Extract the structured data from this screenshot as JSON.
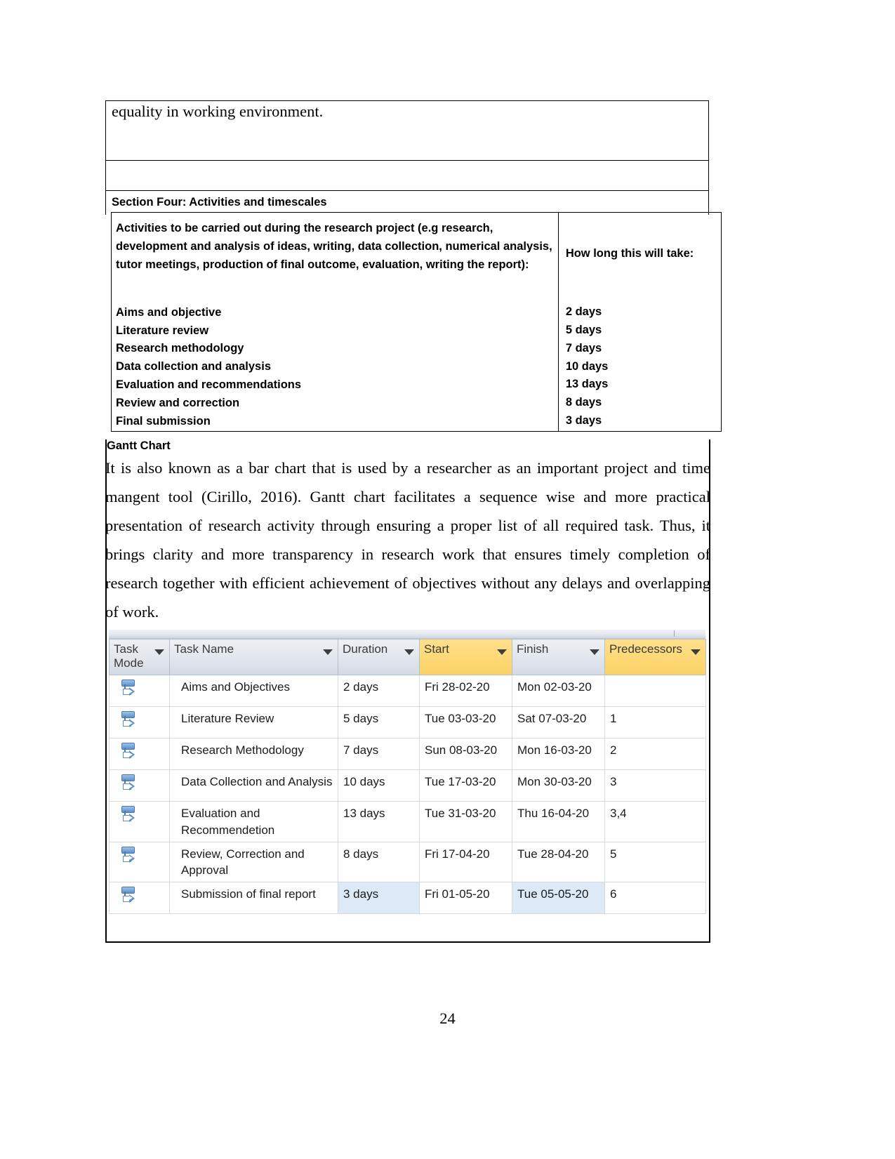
{
  "document": {
    "top_cell_text": "equality in working environment.",
    "section_four_label": "Section Four: Activities and timescales",
    "gantt_heading": "Gantt Chart",
    "gantt_paragraph": "It is also known as a bar chart that is used by a researcher as an important project and time mangent tool (Cirillo, 2016). Gantt chart facilitates a sequence wise and more practical presentation of research activity through ensuring a proper list of all required task. Thus, it brings clarity and  more transparency in research work that ensures timely completion of research together with efficient achievement of objectives without any delays and overlapping of work.",
    "page_number": "24"
  },
  "activities_table": {
    "header_left": "Activities to be carried out during the research project (e.g research, development and analysis of ideas, writing, data collection, numerical analysis, tutor meetings, production of final outcome, evaluation, writing the report):",
    "header_right": "How long this will take:",
    "rows": [
      {
        "activity": "Aims and objective",
        "duration": "2 days"
      },
      {
        "activity": "Literature review",
        "duration": "5 days"
      },
      {
        "activity": "Research methodology",
        "duration": "7 days"
      },
      {
        "activity": "Data collection and analysis",
        "duration": "10 days"
      },
      {
        "activity": "Evaluation and recommendations",
        "duration": "13 days"
      },
      {
        "activity": "Review and correction",
        "duration": "8 days"
      },
      {
        "activity": "Final submission",
        "duration": "3 days"
      }
    ]
  },
  "gantt_table": {
    "columns": [
      {
        "label": "Task Mode",
        "highlight": "none"
      },
      {
        "label": "Task Name",
        "highlight": "none"
      },
      {
        "label": "Duration",
        "highlight": "none"
      },
      {
        "label": "Start",
        "highlight": "gold"
      },
      {
        "label": "Finish",
        "highlight": "none"
      },
      {
        "label": "Predecessors",
        "highlight": "gold"
      }
    ],
    "colors": {
      "header_gold": "#ffd977",
      "header_grey": "#e2e7ee",
      "selection_blue": "#dce9f7",
      "task_mode_icon": "#5b8fc9"
    },
    "rows": [
      {
        "mode_icon": "manually-scheduled-icon",
        "name": "Aims and Objectives",
        "duration": "2 days",
        "start": "Fri 28-02-20",
        "finish": "Mon 02-03-20",
        "predecessors": ""
      },
      {
        "mode_icon": "manually-scheduled-icon",
        "name": "Literature Review",
        "duration": "5 days",
        "start": "Tue 03-03-20",
        "finish": "Sat 07-03-20",
        "predecessors": "1"
      },
      {
        "mode_icon": "manually-scheduled-icon",
        "name": "Research Methodology",
        "duration": "7 days",
        "start": "Sun 08-03-20",
        "finish": "Mon 16-03-20",
        "predecessors": "2"
      },
      {
        "mode_icon": "manually-scheduled-icon",
        "name": "Data Collection and Analysis",
        "duration": "10 days",
        "start": "Tue 17-03-20",
        "finish": "Mon 30-03-20",
        "predecessors": "3"
      },
      {
        "mode_icon": "manually-scheduled-icon",
        "name": "Evaluation and Recommendetion",
        "duration": "13 days",
        "start": "Tue 31-03-20",
        "finish": "Thu 16-04-20",
        "predecessors": "3,4"
      },
      {
        "mode_icon": "manually-scheduled-icon",
        "name": "Review, Correction and Approval",
        "duration": "8 days",
        "start": "Fri 17-04-20",
        "finish": "Tue 28-04-20",
        "predecessors": "5"
      },
      {
        "mode_icon": "manually-scheduled-icon",
        "name": "Submission of final report",
        "duration": "3 days",
        "start": "Fri 01-05-20",
        "finish": "Tue 05-05-20",
        "predecessors": "6",
        "selected_cells": [
          "duration",
          "finish"
        ]
      }
    ]
  }
}
